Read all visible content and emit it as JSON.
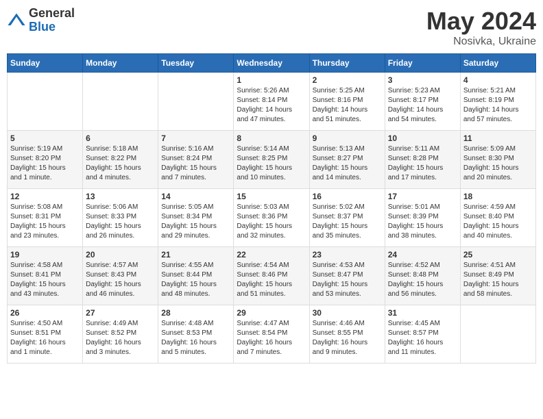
{
  "logo": {
    "general": "General",
    "blue": "Blue"
  },
  "header": {
    "month": "May 2024",
    "location": "Nosivka, Ukraine"
  },
  "weekdays": [
    "Sunday",
    "Monday",
    "Tuesday",
    "Wednesday",
    "Thursday",
    "Friday",
    "Saturday"
  ],
  "weeks": [
    [
      {
        "day": "",
        "info": ""
      },
      {
        "day": "",
        "info": ""
      },
      {
        "day": "",
        "info": ""
      },
      {
        "day": "1",
        "info": "Sunrise: 5:26 AM\nSunset: 8:14 PM\nDaylight: 14 hours\nand 47 minutes."
      },
      {
        "day": "2",
        "info": "Sunrise: 5:25 AM\nSunset: 8:16 PM\nDaylight: 14 hours\nand 51 minutes."
      },
      {
        "day": "3",
        "info": "Sunrise: 5:23 AM\nSunset: 8:17 PM\nDaylight: 14 hours\nand 54 minutes."
      },
      {
        "day": "4",
        "info": "Sunrise: 5:21 AM\nSunset: 8:19 PM\nDaylight: 14 hours\nand 57 minutes."
      }
    ],
    [
      {
        "day": "5",
        "info": "Sunrise: 5:19 AM\nSunset: 8:20 PM\nDaylight: 15 hours\nand 1 minute."
      },
      {
        "day": "6",
        "info": "Sunrise: 5:18 AM\nSunset: 8:22 PM\nDaylight: 15 hours\nand 4 minutes."
      },
      {
        "day": "7",
        "info": "Sunrise: 5:16 AM\nSunset: 8:24 PM\nDaylight: 15 hours\nand 7 minutes."
      },
      {
        "day": "8",
        "info": "Sunrise: 5:14 AM\nSunset: 8:25 PM\nDaylight: 15 hours\nand 10 minutes."
      },
      {
        "day": "9",
        "info": "Sunrise: 5:13 AM\nSunset: 8:27 PM\nDaylight: 15 hours\nand 14 minutes."
      },
      {
        "day": "10",
        "info": "Sunrise: 5:11 AM\nSunset: 8:28 PM\nDaylight: 15 hours\nand 17 minutes."
      },
      {
        "day": "11",
        "info": "Sunrise: 5:09 AM\nSunset: 8:30 PM\nDaylight: 15 hours\nand 20 minutes."
      }
    ],
    [
      {
        "day": "12",
        "info": "Sunrise: 5:08 AM\nSunset: 8:31 PM\nDaylight: 15 hours\nand 23 minutes."
      },
      {
        "day": "13",
        "info": "Sunrise: 5:06 AM\nSunset: 8:33 PM\nDaylight: 15 hours\nand 26 minutes."
      },
      {
        "day": "14",
        "info": "Sunrise: 5:05 AM\nSunset: 8:34 PM\nDaylight: 15 hours\nand 29 minutes."
      },
      {
        "day": "15",
        "info": "Sunrise: 5:03 AM\nSunset: 8:36 PM\nDaylight: 15 hours\nand 32 minutes."
      },
      {
        "day": "16",
        "info": "Sunrise: 5:02 AM\nSunset: 8:37 PM\nDaylight: 15 hours\nand 35 minutes."
      },
      {
        "day": "17",
        "info": "Sunrise: 5:01 AM\nSunset: 8:39 PM\nDaylight: 15 hours\nand 38 minutes."
      },
      {
        "day": "18",
        "info": "Sunrise: 4:59 AM\nSunset: 8:40 PM\nDaylight: 15 hours\nand 40 minutes."
      }
    ],
    [
      {
        "day": "19",
        "info": "Sunrise: 4:58 AM\nSunset: 8:41 PM\nDaylight: 15 hours\nand 43 minutes."
      },
      {
        "day": "20",
        "info": "Sunrise: 4:57 AM\nSunset: 8:43 PM\nDaylight: 15 hours\nand 46 minutes."
      },
      {
        "day": "21",
        "info": "Sunrise: 4:55 AM\nSunset: 8:44 PM\nDaylight: 15 hours\nand 48 minutes."
      },
      {
        "day": "22",
        "info": "Sunrise: 4:54 AM\nSunset: 8:46 PM\nDaylight: 15 hours\nand 51 minutes."
      },
      {
        "day": "23",
        "info": "Sunrise: 4:53 AM\nSunset: 8:47 PM\nDaylight: 15 hours\nand 53 minutes."
      },
      {
        "day": "24",
        "info": "Sunrise: 4:52 AM\nSunset: 8:48 PM\nDaylight: 15 hours\nand 56 minutes."
      },
      {
        "day": "25",
        "info": "Sunrise: 4:51 AM\nSunset: 8:49 PM\nDaylight: 15 hours\nand 58 minutes."
      }
    ],
    [
      {
        "day": "26",
        "info": "Sunrise: 4:50 AM\nSunset: 8:51 PM\nDaylight: 16 hours\nand 1 minute."
      },
      {
        "day": "27",
        "info": "Sunrise: 4:49 AM\nSunset: 8:52 PM\nDaylight: 16 hours\nand 3 minutes."
      },
      {
        "day": "28",
        "info": "Sunrise: 4:48 AM\nSunset: 8:53 PM\nDaylight: 16 hours\nand 5 minutes."
      },
      {
        "day": "29",
        "info": "Sunrise: 4:47 AM\nSunset: 8:54 PM\nDaylight: 16 hours\nand 7 minutes."
      },
      {
        "day": "30",
        "info": "Sunrise: 4:46 AM\nSunset: 8:55 PM\nDaylight: 16 hours\nand 9 minutes."
      },
      {
        "day": "31",
        "info": "Sunrise: 4:45 AM\nSunset: 8:57 PM\nDaylight: 16 hours\nand 11 minutes."
      },
      {
        "day": "",
        "info": ""
      }
    ]
  ]
}
